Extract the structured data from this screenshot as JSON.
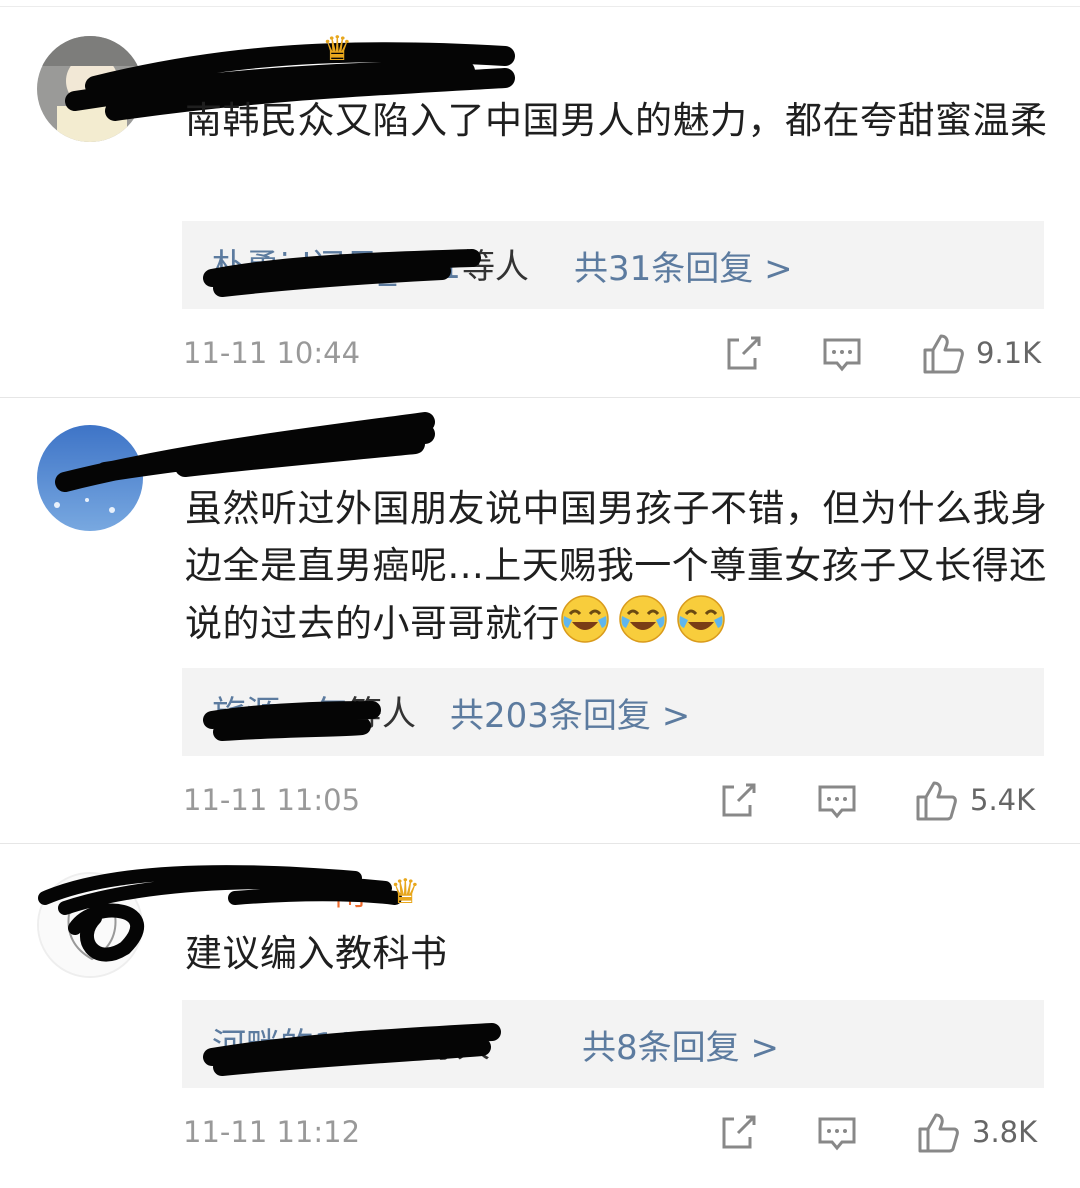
{
  "comments": [
    {
      "username": "",
      "text": "南韩民众又陷入了中国男人的魅力，都在夸甜蜜温柔",
      "replies": {
        "names": "朴勇jd闽丹_701",
        "names_suffix": "等人",
        "count_label": "共31条回复 >"
      },
      "time": "11-11 10:44",
      "likes": "9.1K",
      "has_crown": true
    },
    {
      "username": "uz",
      "text": "虽然听过外国朋友说中国男孩子不错，但为什么我身边全是直男癌呢...上天赐我一个尊重女孩子又长得还说的过去的小哥哥就行",
      "replies": {
        "names": "旅源一年",
        "names_suffix": "等人",
        "count_label": "共203条回复 >"
      },
      "time": "11-11 11:05",
      "likes": "5.4K",
      "has_crown": false,
      "emoji_count": 3
    },
    {
      "username": "闲-",
      "text": "建议编入教科书",
      "replies": {
        "names": "河畔的10201",
        "names_suffix": "等人",
        "count_label": "共8条回复 >"
      },
      "time": "11-11 11:12",
      "likes": "3.8K",
      "has_crown": true
    }
  ],
  "icons": {
    "share": "share-icon",
    "comment": "comment-icon",
    "like": "thumbs-up-icon",
    "crown": "crown-icon",
    "emoji": "laugh-cry-emoji"
  },
  "colors": {
    "link": "#5c7b9f",
    "meta": "#999999",
    "reply_bg": "#f3f3f3",
    "crown": "#e8a71d"
  }
}
